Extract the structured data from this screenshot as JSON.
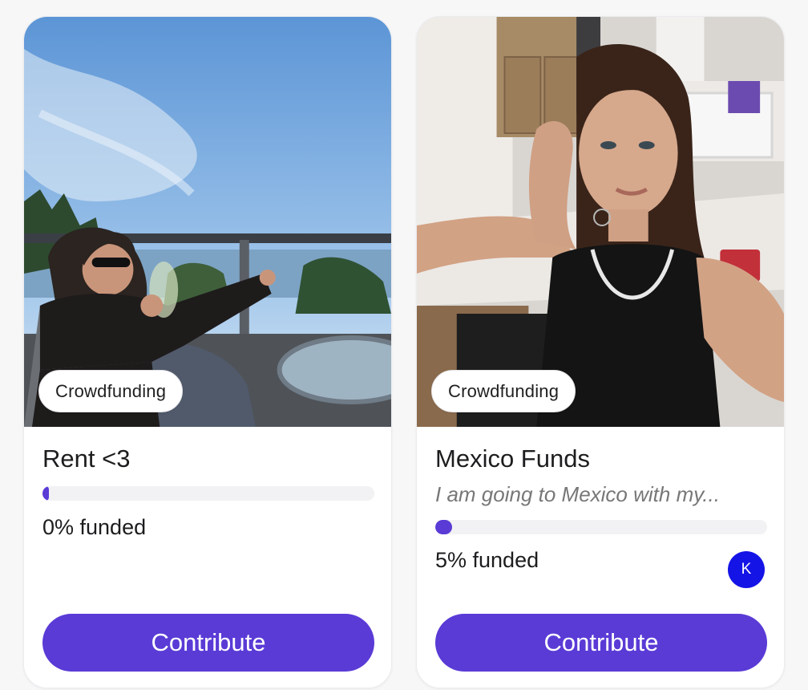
{
  "colors": {
    "accent": "#5a3bd6",
    "avatar": "#1414e6",
    "track": "#f2f2f4"
  },
  "cards": [
    {
      "tag": "Crowdfunding",
      "title": "Rent <3",
      "funded_text": "0% funded",
      "progress_fraction": 0.0,
      "button_label": "Contribute"
    },
    {
      "tag": "Crowdfunding",
      "title": "Mexico Funds",
      "description": "I am going to Mexico with my...",
      "funded_text": "5% funded",
      "progress_fraction": 0.05,
      "avatar_initial": "K",
      "button_label": "Contribute"
    }
  ]
}
